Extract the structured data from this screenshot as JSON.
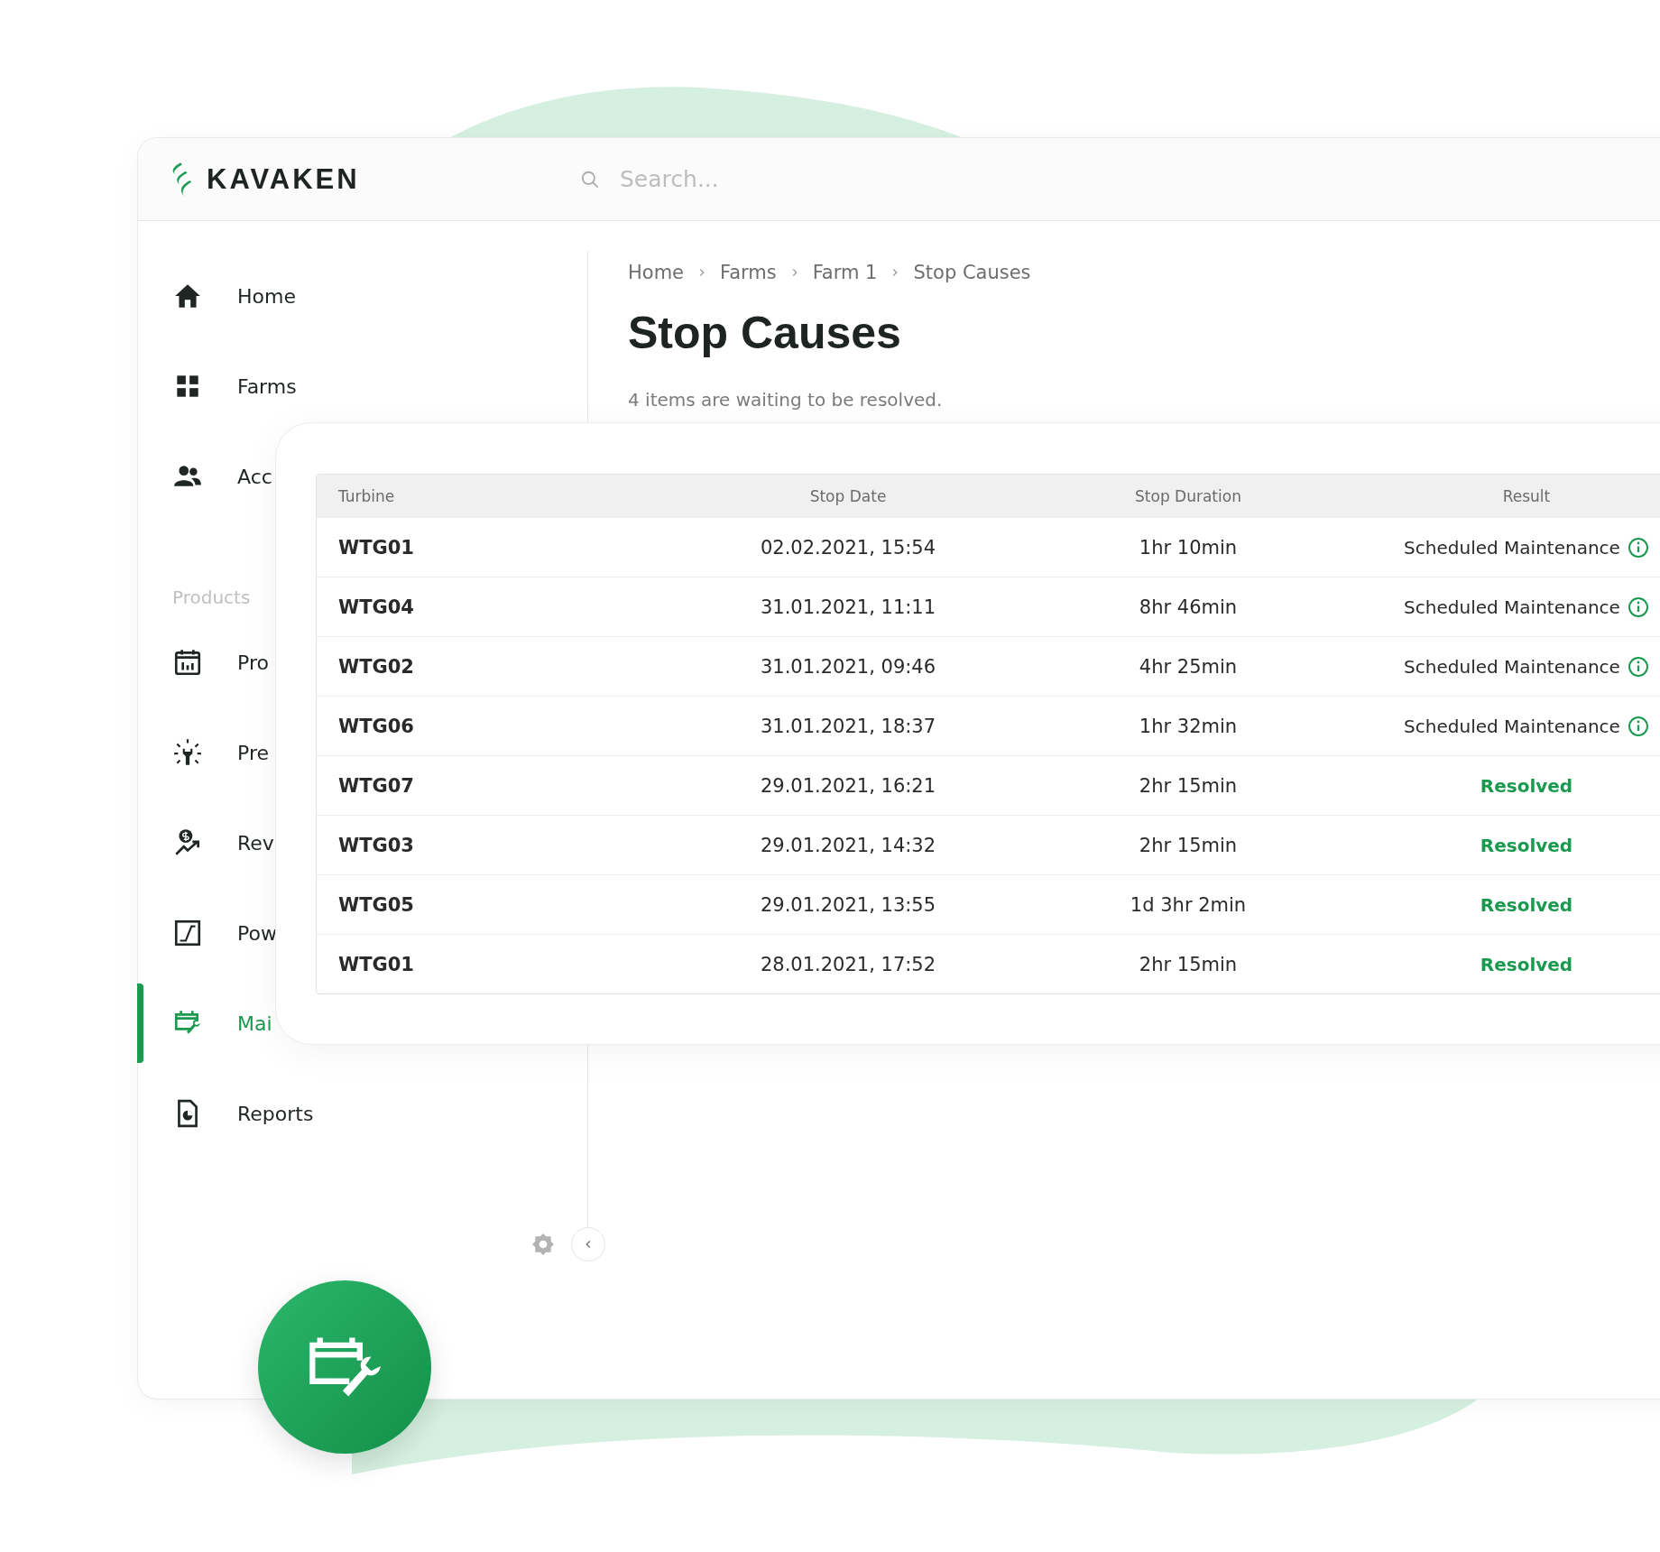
{
  "header": {
    "logo": "KAVAKEN",
    "search": {
      "placeholder": "Search..."
    }
  },
  "sidebar": {
    "items": [
      {
        "label": "Home",
        "selected": false
      },
      {
        "label": "Farms",
        "selected": false
      },
      {
        "label": "Acc",
        "selected": false
      }
    ],
    "sections": [
      {
        "label": "Products",
        "items": [
          {
            "label": "Pro",
            "selected": false
          },
          {
            "label": "Pre",
            "selected": false
          },
          {
            "label": "Rev",
            "selected": false
          },
          {
            "label": "Pow",
            "selected": false
          },
          {
            "label": "Mai",
            "selected": true
          },
          {
            "label": "Reports",
            "selected": false
          }
        ]
      }
    ]
  },
  "breadcrumb": [
    "Home",
    "Farms",
    "Farm 1",
    "Stop Causes"
  ],
  "title": "Stop Causes",
  "subtitle": "4 items are waiting to be resolved.",
  "table": {
    "columns": [
      "Turbine",
      "Stop Date",
      "Stop Duration",
      "Result"
    ],
    "rows": [
      {
        "turbine": "WTG01",
        "stop_date": "02.02.2021, 15:54",
        "duration": "1hr 10min",
        "result": {
          "kind": "scheduled",
          "text": "Scheduled Maintenance"
        }
      },
      {
        "turbine": "WTG04",
        "stop_date": "31.01.2021, 11:11",
        "duration": "8hr 46min",
        "result": {
          "kind": "scheduled",
          "text": "Scheduled Maintenance"
        }
      },
      {
        "turbine": "WTG02",
        "stop_date": "31.01.2021, 09:46",
        "duration": "4hr 25min",
        "result": {
          "kind": "scheduled",
          "text": "Scheduled Maintenance"
        }
      },
      {
        "turbine": "WTG06",
        "stop_date": "31.01.2021, 18:37",
        "duration": "1hr 32min",
        "result": {
          "kind": "scheduled",
          "text": "Scheduled Maintenance"
        }
      },
      {
        "turbine": "WTG07",
        "stop_date": "29.01.2021, 16:21",
        "duration": "2hr 15min",
        "result": {
          "kind": "resolved",
          "text": "Resolved"
        }
      },
      {
        "turbine": "WTG03",
        "stop_date": "29.01.2021, 14:32",
        "duration": "2hr 15min",
        "result": {
          "kind": "resolved",
          "text": "Resolved"
        }
      },
      {
        "turbine": "WTG05",
        "stop_date": "29.01.2021, 13:55",
        "duration": "1d 3hr 2min",
        "result": {
          "kind": "resolved",
          "text": "Resolved"
        }
      },
      {
        "turbine": "WTG01",
        "stop_date": "28.01.2021, 17:52",
        "duration": "2hr 15min",
        "result": {
          "kind": "resolved",
          "text": "Resolved"
        }
      }
    ]
  }
}
